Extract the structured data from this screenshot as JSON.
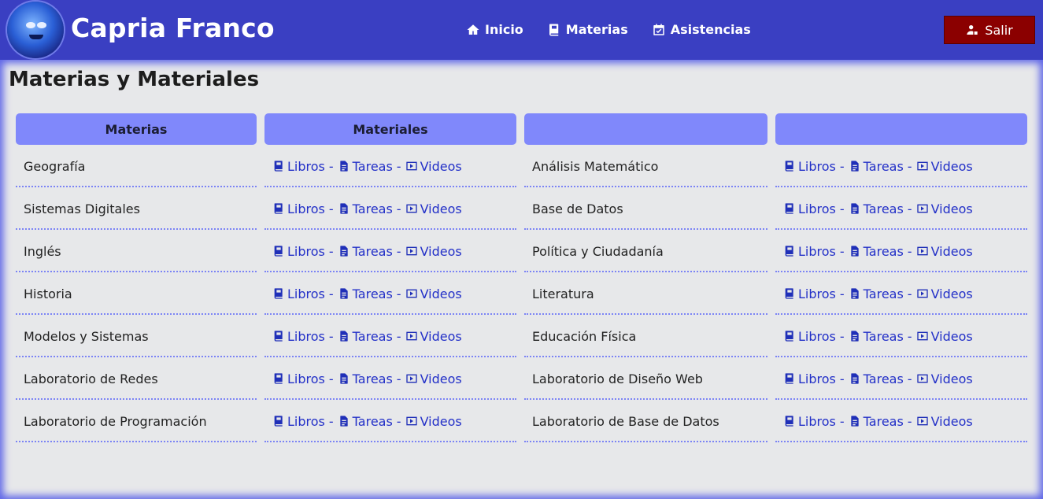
{
  "header": {
    "brand": "Capria Franco",
    "nav": [
      {
        "label": "Inicio",
        "icon": "home-icon"
      },
      {
        "label": "Materias",
        "icon": "book-icon"
      },
      {
        "label": "Asistencias",
        "icon": "calendar-check-icon"
      }
    ],
    "logout_label": "Salir"
  },
  "page": {
    "title": "Materias y Materiales"
  },
  "table": {
    "headers": [
      "Materias",
      "Materiales",
      "",
      ""
    ],
    "link_labels": {
      "books": "Libros",
      "tasks": "Tareas",
      "videos": "Videos",
      "separator": "-"
    },
    "left_subjects": [
      "Geografía",
      "Sistemas Digitales",
      "Inglés",
      "Historia",
      "Modelos y Sistemas",
      "Laboratorio de Redes",
      "Laboratorio de Programación"
    ],
    "right_subjects": [
      "Análisis Matemático",
      "Base de Datos",
      "Política y Ciudadanía",
      "Literatura",
      "Educación Física",
      "Laboratorio de Diseño Web",
      "Laboratorio de Base de Datos"
    ]
  },
  "colors": {
    "header_bg": "#3a3fc2",
    "column_header_bg": "#8088fb",
    "link": "#2330c8",
    "logout_bg": "#8b0000",
    "content_bg": "#e7e8ea"
  }
}
